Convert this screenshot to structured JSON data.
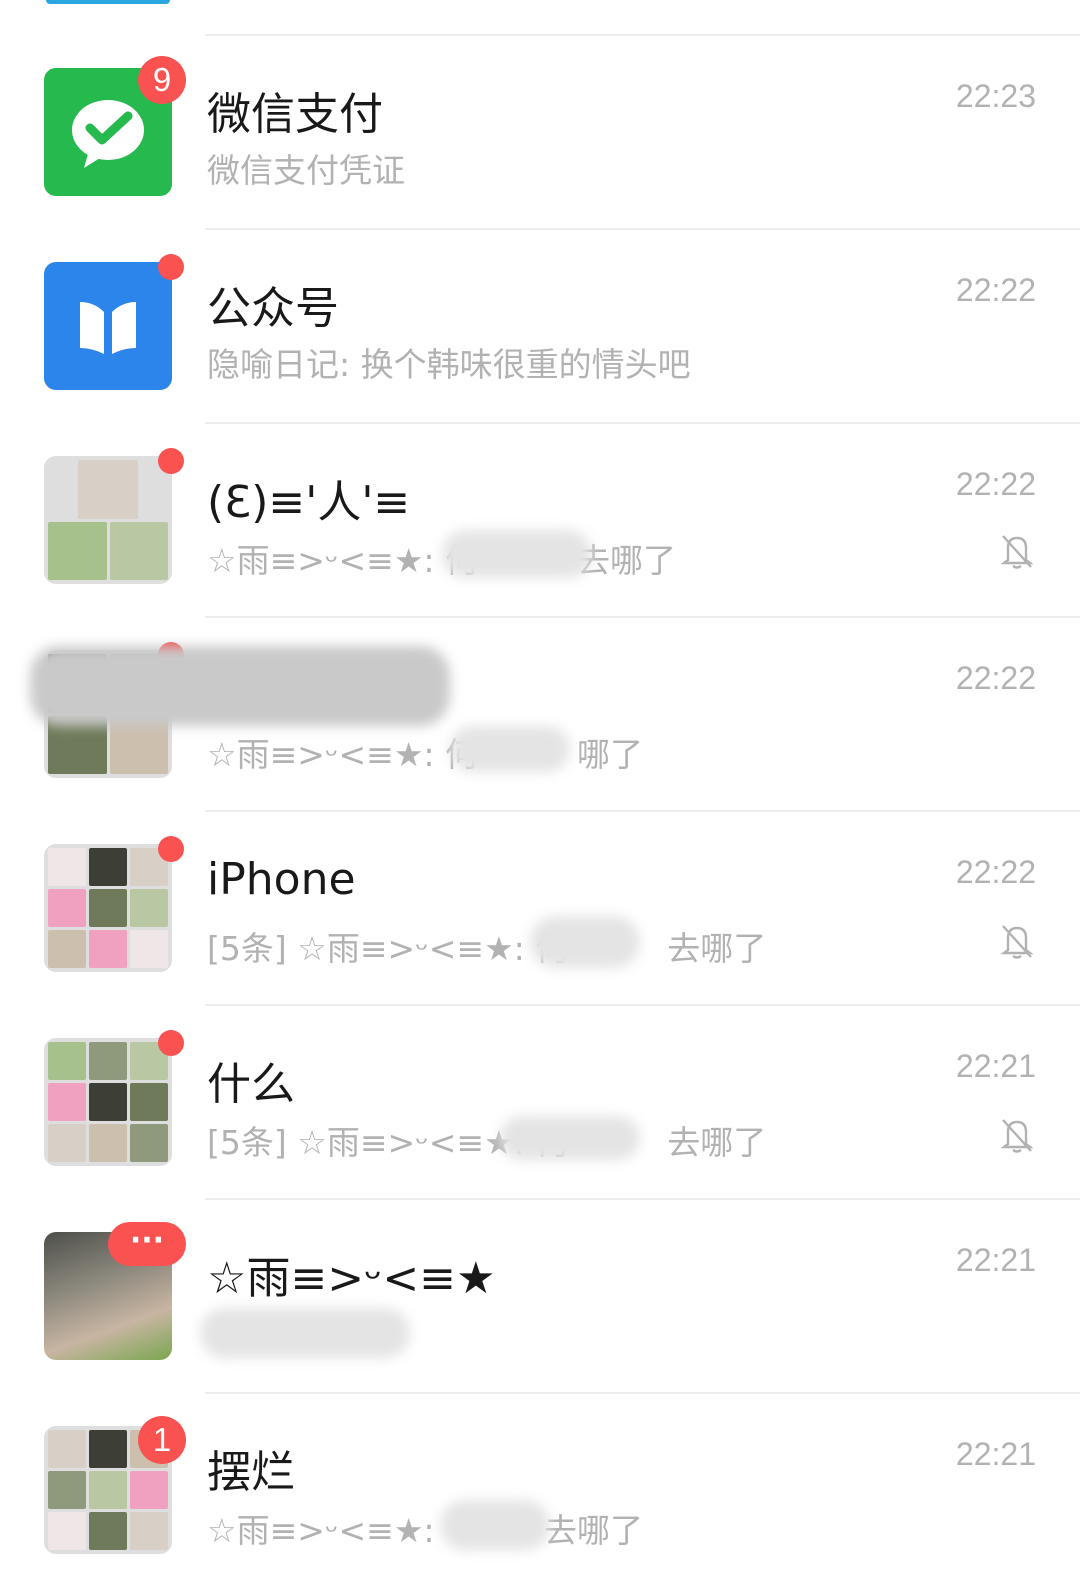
{
  "chats": [
    {
      "name": "微信支付",
      "preview": "微信支付凭证",
      "time": "22:23",
      "badge": "9",
      "muted": false
    },
    {
      "name": "公众号",
      "preview": "隐喻日记: 换个韩味很重的情头吧",
      "time": "22:22",
      "badge": "dot",
      "muted": false
    },
    {
      "name": "(Ɛ)≡'人'≡",
      "preview": "☆雨≡>ᵕ<≡★: 何　　　去哪了",
      "time": "22:22",
      "badge": "dot",
      "muted": true
    },
    {
      "name": "",
      "preview": "☆雨≡>ᵕ<≡★: 何　　　哪了",
      "time": "22:22",
      "badge": "dot",
      "muted": false
    },
    {
      "name": "iPhone",
      "preview": "[5条] ☆雨≡>ᵕ<≡★: 何　　　去哪了",
      "time": "22:22",
      "badge": "dot",
      "muted": true
    },
    {
      "name": "什么",
      "preview": "[5条] ☆雨≡>ᵕ<≡★: 何　　　去哪了",
      "time": "22:21",
      "badge": "dot",
      "muted": true
    },
    {
      "name": "☆雨≡>ᵕ<≡★",
      "preview": "",
      "time": "22:21",
      "badge": "···",
      "muted": false
    },
    {
      "name": "摆烂",
      "preview": "☆雨≡>ᵕ<≡★: 　　　去哪了",
      "time": "22:21",
      "badge": "1",
      "muted": false
    }
  ],
  "colors": {
    "badge": "#fa5151",
    "pay_green": "#26b94d",
    "official_blue": "#2b85ea"
  },
  "icons": {
    "pay": "wechat-pay-icon",
    "official": "official-account-icon",
    "mute": "bell-off-icon"
  }
}
